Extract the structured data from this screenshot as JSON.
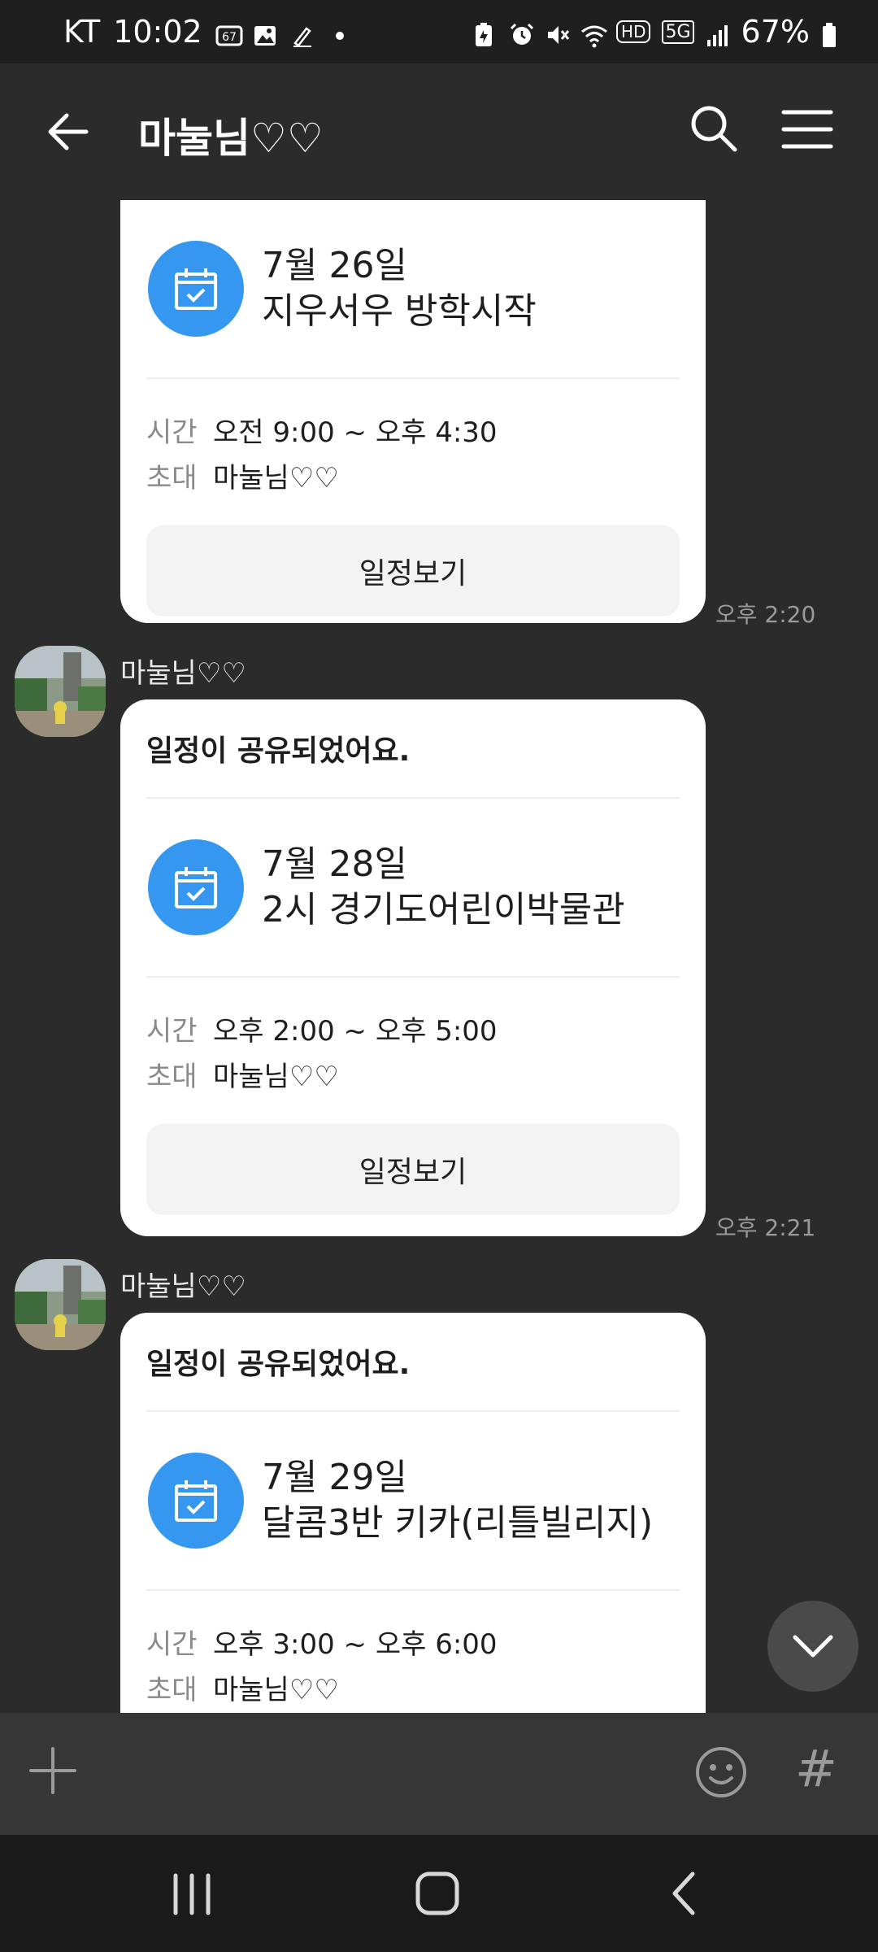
{
  "status_bar": {
    "carrier": "KT",
    "time": "10:02",
    "battery": "67%",
    "network_label": "5G",
    "hd_label": "HD",
    "notif_number": "67"
  },
  "header": {
    "title": "마눌님♡♡"
  },
  "messages": [
    {
      "event_date": "7월 26일",
      "event_title": "지우서우 방학시작",
      "time_label": "시간",
      "time_value": "오전 9:00 ~ 오후 4:30",
      "invite_label": "초대",
      "invite_value": "마눌님♡♡",
      "button_label": "일정보기",
      "sent_time": "오후 2:20"
    },
    {
      "sender": "마눌님♡♡",
      "heading": "일정이 공유되었어요.",
      "event_date": "7월 28일",
      "event_title": "2시 경기도어린이박물관",
      "time_label": "시간",
      "time_value": "오후 2:00 ~ 오후 5:00",
      "invite_label": "초대",
      "invite_value": "마눌님♡♡",
      "button_label": "일정보기",
      "sent_time": "오후 2:21"
    },
    {
      "sender": "마눌님♡♡",
      "heading": "일정이 공유되었어요.",
      "event_date": "7월 29일",
      "event_title": "달콤3반 키카(리틀빌리지)",
      "time_label": "시간",
      "time_value": "오후 3:00 ~ 오후 6:00",
      "invite_label": "초대",
      "invite_value": "마눌님♡♡"
    }
  ],
  "input_bar": {
    "hash_symbol": "#"
  },
  "colors": {
    "background": "#2b2b2b",
    "card": "#ffffff",
    "calendar_accent": "#3597f0",
    "button_bg": "#f3f3f3"
  }
}
